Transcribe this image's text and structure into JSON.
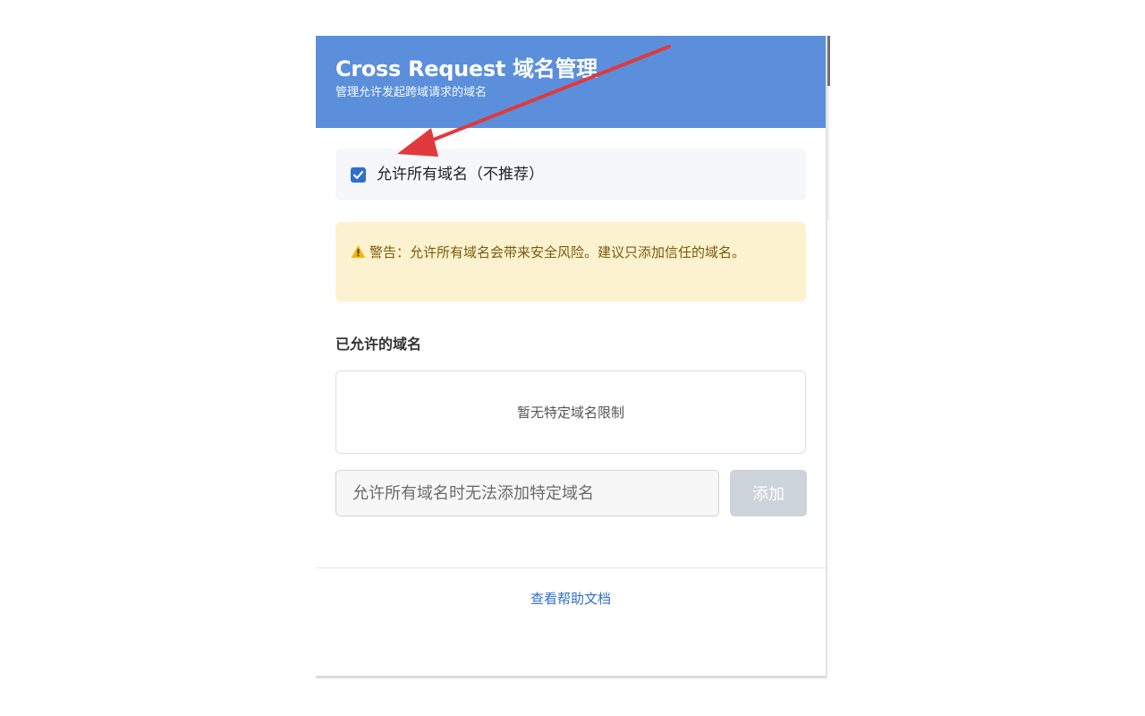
{
  "header": {
    "title": "Cross Request 域名管理",
    "subtitle": "管理允许发起跨域请求的域名"
  },
  "allow_all": {
    "label": "允许所有域名（不推荐）",
    "checked": true
  },
  "warning": {
    "icon": "warning-icon",
    "text": "警告：允许所有域名会带来安全风险。建议只添加信任的域名。"
  },
  "allowed_domains": {
    "title": "已允许的域名",
    "empty_text": "暂无特定域名限制",
    "items": []
  },
  "add_domain": {
    "placeholder": "允许所有域名时无法添加特定域名",
    "value": "",
    "disabled": true,
    "button_label": "添加"
  },
  "footer": {
    "help_link": "查看帮助文档"
  },
  "colors": {
    "header_bg": "#5b8fdc",
    "warning_bg": "#fdf2cf",
    "warning_text": "#7a5a0c",
    "link": "#2f6fd0",
    "annotation_arrow": "#e0393e"
  }
}
